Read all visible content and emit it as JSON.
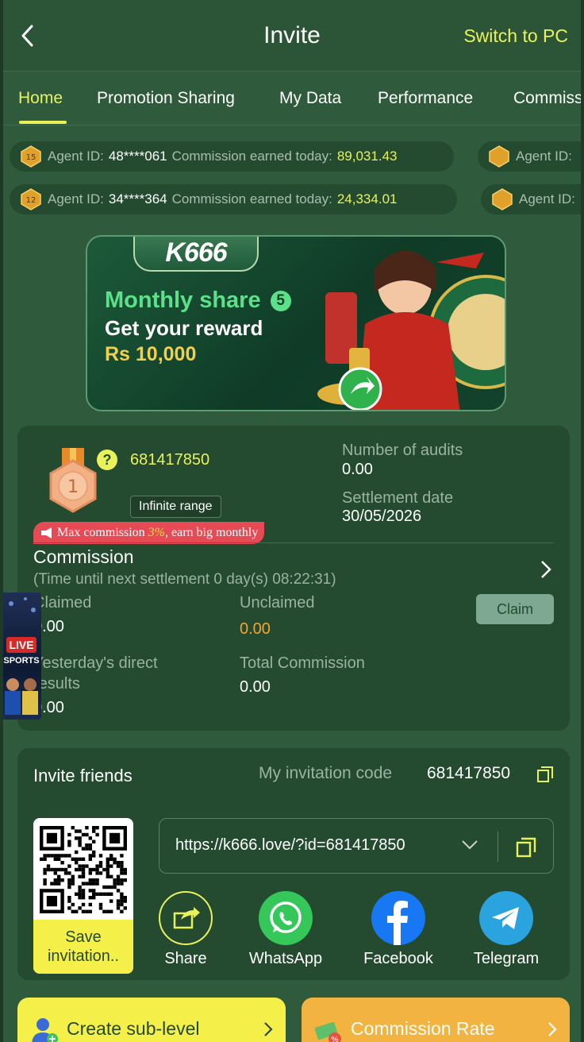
{
  "header": {
    "title": "Invite",
    "switch_label": "Switch to PC"
  },
  "tabs": [
    {
      "label": "Home",
      "active": true
    },
    {
      "label": "Promotion Sharing"
    },
    {
      "label": "My Data"
    },
    {
      "label": "Performance"
    },
    {
      "label": "Commiss"
    }
  ],
  "ticker": {
    "agent_label": "Agent ID:",
    "commission_label": "Commission earned today:",
    "rows": [
      {
        "agent_id": "48****061",
        "amount": "89,031.43",
        "badge_level": "15",
        "next_label": "Agent ID:"
      },
      {
        "agent_id": "34****364",
        "amount": "24,334.01",
        "badge_level": "12",
        "next_label": "Agent ID:"
      }
    ]
  },
  "banner": {
    "logo": "K666",
    "line1": "Monthly share",
    "line1_badge": "5",
    "line2": "Get your reward",
    "line3": "Rs 10,000"
  },
  "agent": {
    "rank": "1",
    "help_icon": "?",
    "id": "681417850",
    "range_label": "Infinite range",
    "max_commission_pre": "Max commission ",
    "max_commission_pct": "3%",
    "max_commission_post": ", earn big monthly",
    "audits_label": "Number of audits",
    "audits_value": "0.00",
    "settlement_label": "Settlement date",
    "settlement_value": "30/05/2026",
    "commission_title": "Commission",
    "commission_sub": "(Time until next settlement  0 day(s) 08:22:31)",
    "claimed_label": "Claimed",
    "claimed_value": "0.00",
    "unclaimed_label": "Unclaimed",
    "unclaimed_value": "0.00",
    "claim_button": "Claim",
    "yesterday_label_1": "Yesterday's direct",
    "yesterday_label_2": "results",
    "yesterday_value": "0.00",
    "total_label": "Total Commission",
    "total_value": "0.00"
  },
  "live_widget": {
    "tag": "LIVE",
    "sub": "SPORTS"
  },
  "invite": {
    "title": "Invite friends",
    "code_label": "My invitation code",
    "code_value": "681417850",
    "save_label": "Save invitation..",
    "link": "https://k666.love/?id=681417850",
    "share_items": [
      {
        "label": "Share",
        "icon": "share-icon",
        "color": "#244a2f"
      },
      {
        "label": "WhatsApp",
        "icon": "whatsapp-icon",
        "color": "#35c75a"
      },
      {
        "label": "Facebook",
        "icon": "facebook-icon",
        "color": "#1877f2"
      },
      {
        "label": "Telegram",
        "icon": "telegram-icon",
        "color": "#2aa3df"
      }
    ]
  },
  "bottom": {
    "create_sub_level": "Create sub-level",
    "commission_rate": "Commission Rate"
  },
  "colors": {
    "accent": "#e9f25a",
    "background": "#2f5a3b",
    "card": "#244a2f",
    "orange": "#f4a52e",
    "red": "#e64a55"
  }
}
